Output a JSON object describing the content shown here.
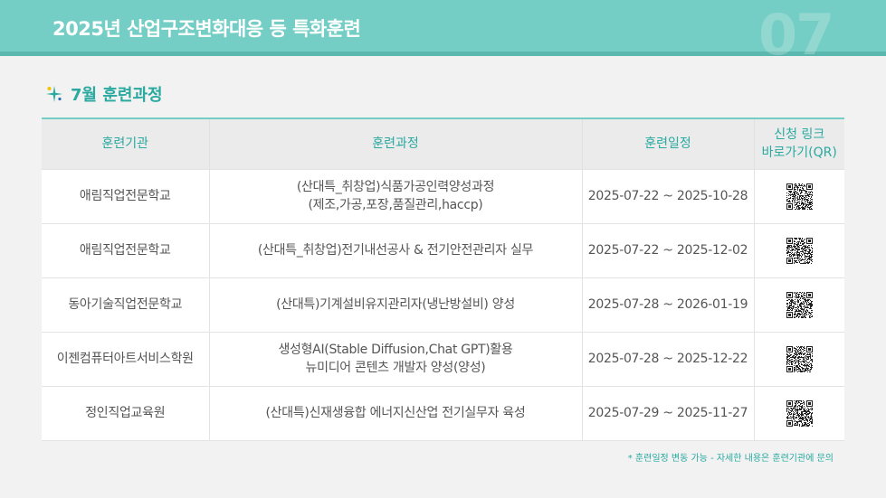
{
  "header": {
    "title": "2025년 산업구조변화대응 등 특화훈련",
    "page_number": "07"
  },
  "section": {
    "title": "7월 훈련과정",
    "icon": "sparkle-icon"
  },
  "table": {
    "headers": {
      "institution": "훈련기관",
      "course": "훈련과정",
      "schedule": "훈련일정",
      "link_line1": "신청 링크",
      "link_line2": "바로가기(QR)"
    },
    "rows": [
      {
        "institution": "애림직업전문학교",
        "course_line1": "(산대특_취창업)식품가공인력양성과정",
        "course_line2": "(제조,가공,포장,품질관리,haccp)",
        "schedule": "2025-07-22 ~ 2025-10-28"
      },
      {
        "institution": "애림직업전문학교",
        "course_line1": "(산대특_취창업)전기내선공사 & 전기안전관리자 실무",
        "course_line2": "",
        "schedule": "2025-07-22 ~ 2025-12-02"
      },
      {
        "institution": "동아기술직업전문학교",
        "course_line1": "(산대특)기계설비유지관리자(냉난방설비) 양성",
        "course_line2": "",
        "schedule": "2025-07-28 ~ 2026-01-19"
      },
      {
        "institution": "이젠컴퓨터아트서비스학원",
        "course_line1": "생성형AI(Stable Diffusion,Chat GPT)활용",
        "course_line2": "뉴미디어 콘텐츠 개발자 양성(양성)",
        "schedule": "2025-07-28 ~ 2025-12-22"
      },
      {
        "institution": "정인직업교육원",
        "course_line1": "(산대특)신재생융합 에너지신산업 전기실무자 육성",
        "course_line2": "",
        "schedule": "2025-07-29 ~ 2025-11-27"
      }
    ]
  },
  "footnote": "* 훈련일정 변동 가능 - 자세한 내용은 훈련기관에 문의",
  "colors": {
    "accent": "#74cec5",
    "accent_text": "#2aa9a0"
  }
}
